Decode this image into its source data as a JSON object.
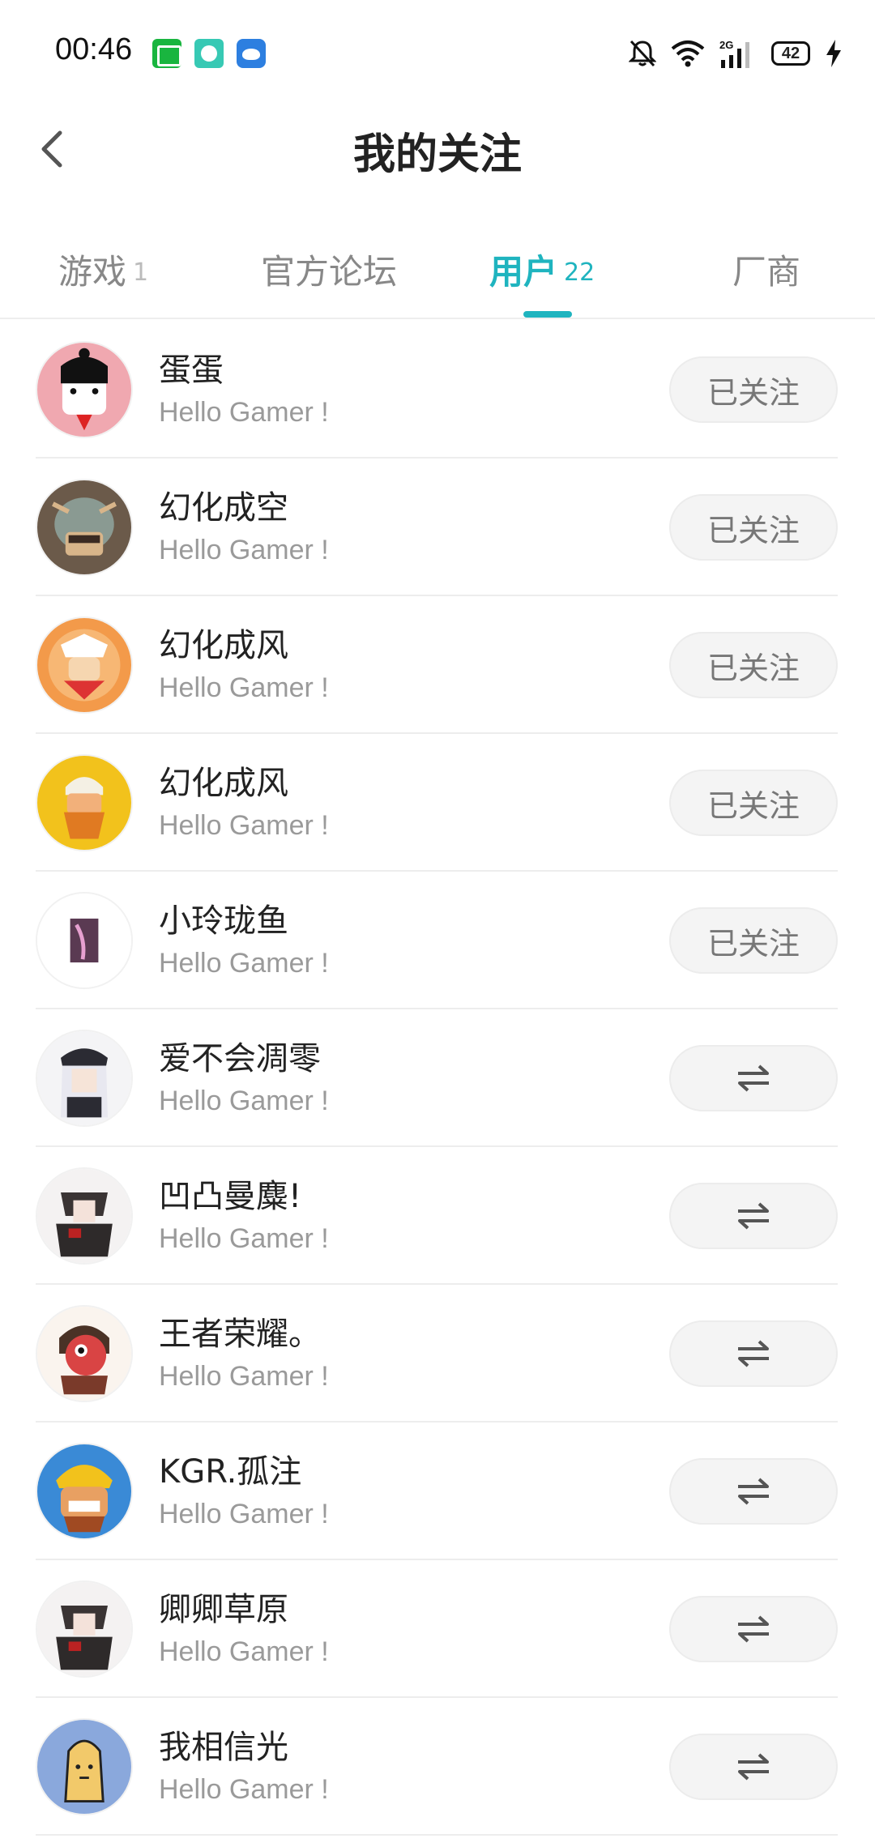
{
  "status_bar": {
    "time": "00:46",
    "battery": "42",
    "network": "2G"
  },
  "header": {
    "title": "我的关注"
  },
  "tabs": [
    {
      "label": "游戏",
      "count": "1"
    },
    {
      "label": "官方论坛",
      "count": ""
    },
    {
      "label": "用户",
      "count": "22"
    },
    {
      "label": "厂商",
      "count": ""
    }
  ],
  "users": [
    {
      "name": "蛋蛋",
      "bio": "Hello Gamer !",
      "button": "已关注"
    },
    {
      "name": "幻化成空",
      "bio": "Hello Gamer !",
      "button": "已关注"
    },
    {
      "name": "幻化成风",
      "bio": "Hello Gamer !",
      "button": "已关注"
    },
    {
      "name": "幻化成风",
      "bio": "Hello Gamer !",
      "button": "已关注"
    },
    {
      "name": "小玲珑鱼",
      "bio": "Hello Gamer !",
      "button": "已关注"
    },
    {
      "name": "爱不会凋零",
      "bio": "Hello Gamer !",
      "button": ""
    },
    {
      "name": "凹凸曼麋!",
      "bio": "Hello Gamer !",
      "button": ""
    },
    {
      "name": "王者荣耀。",
      "bio": "Hello Gamer !",
      "button": ""
    },
    {
      "name": "KGR.孤注",
      "bio": "Hello Gamer !",
      "button": ""
    },
    {
      "name": "卿卿草原",
      "bio": "Hello Gamer !",
      "button": ""
    },
    {
      "name": "我相信光",
      "bio": "Hello Gamer !",
      "button": ""
    }
  ],
  "colors": {
    "accent": "#1fb4bf",
    "muted_text": "#9a9a9a",
    "button_bg": "#f4f4f4"
  },
  "icons": {
    "back": "chevron-left-icon",
    "mutual": "mutual-follow-icon",
    "notifications": "bell-off-icon",
    "wifi": "wifi-icon",
    "signal": "signal-icon",
    "charging": "bolt-icon"
  }
}
